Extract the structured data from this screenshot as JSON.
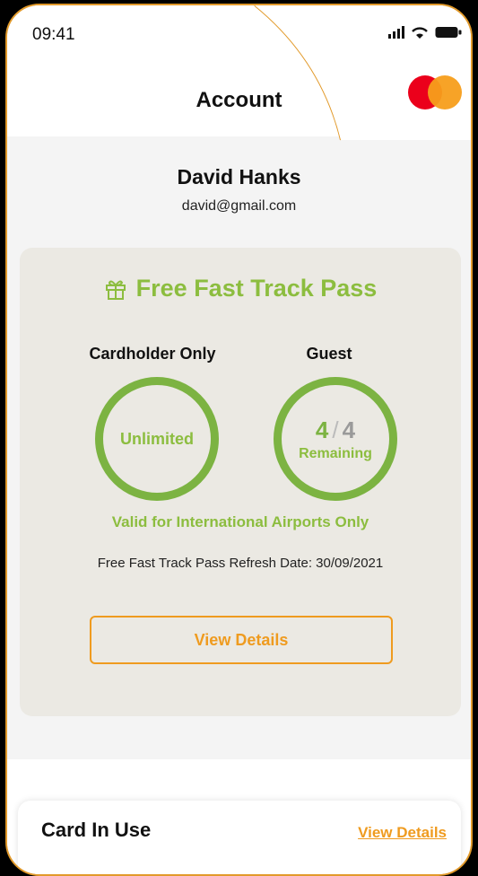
{
  "status_bar": {
    "time": "09:41"
  },
  "header": {
    "title": "Account",
    "card_brand_icon": "mastercard-icon"
  },
  "profile": {
    "name": "David Hanks",
    "email": "david@gmail.com"
  },
  "pass": {
    "title": "Free Fast Track Pass",
    "icon": "gift-icon",
    "cardholder": {
      "label": "Cardholder Only",
      "value": "Unlimited"
    },
    "guest": {
      "label": "Guest",
      "used": "4",
      "total": "4",
      "unit": "Remaining"
    },
    "valid_text": "Valid for International Airports Only",
    "refresh_text": "Free Fast Track Pass Refresh Date: 30/09/2021",
    "button_label": "View Details"
  },
  "card_in_use": {
    "title": "Card In Use",
    "link_label": "View Details"
  },
  "colors": {
    "accent_orange": "#ef9b1f",
    "accent_green": "#8cbd3f",
    "frame": "#e29a2b"
  }
}
